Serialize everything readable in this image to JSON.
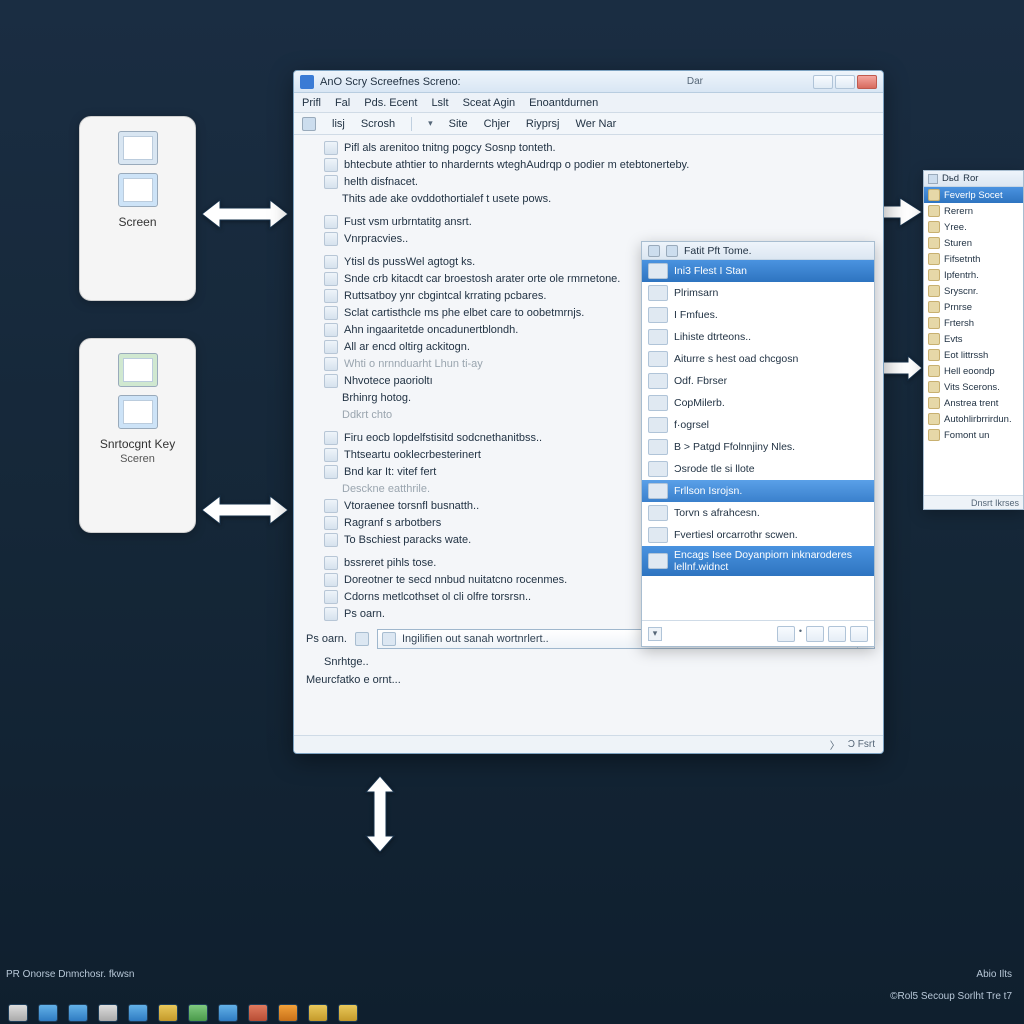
{
  "cards": [
    {
      "label": "Screen"
    },
    {
      "label": "Snrtocgnt Key",
      "sublabel": "Sceren"
    }
  ],
  "window": {
    "title": "AnO Scry Screefnes Screno:",
    "subtitle": "Dar",
    "menu": [
      "Prifl",
      "Fal",
      "Pds. Ecent",
      "Lslt",
      "Sceat Agin",
      "Enoantdurnen"
    ],
    "toolbar": [
      "lisj",
      "Scrosh",
      "Site",
      "Chjer",
      "Riyprsj",
      "Wer Nar"
    ],
    "items": [
      "Pifl als arenitoo tnitng pogcy Sosnp tonteth.",
      "bhtecbute athtier to nhardernts wteghAudrqp o podier m etebtonerteby.",
      "helth disfnacet.",
      "Thits ade ake ovddothortialef t usete pows.",
      "Fust vsm urbrntatitg ansrt.",
      "Vnrpracvies..",
      "Ytisl ds pussWel agtogt ks.",
      "Snde crb kitacdt car broestosh arater orte ole rmrnetone.",
      "Ruttsatboy ynr cbgintcal krrating pcbares.",
      "Sclat cartisthcle ms phe elbet care to oobetmrnjs.",
      "Ahn ingaaritetde oncadunertblondh.",
      "All ar encd oltirg ackitogn.",
      "Whti  o nrnnduarht  Lhun ti‑ay",
      "Nhvotece paorioltı",
      "Brhinrg hotog.",
      "Ddkrt chto",
      "Firu eocb lopdelfstisitd sodcnethanitbss..",
      "Thtseartu ooklecrbesterinert",
      "Bnd kar It: vitef fert",
      "Desckne eatthrile.",
      "Vtoraenee torsnfl busnatth..",
      "Ragranf s arbotbers",
      "To Bschiest paracks wate.",
      "bssreret pihls tose.",
      "Doreotner te secd nnbud nuitatcno rocenmes.",
      "Cdorns metlcothset ol cli olfre torsrsn..",
      "Ps   oarn."
    ],
    "combo": {
      "label": "Ps   oarn.",
      "value": "Ingilifien out sanah wortnrlert.."
    },
    "footer_items": [
      "Snrhtge..",
      "Meurcfatko e ornt..."
    ],
    "status": [
      "〉",
      "Ɔ Fsrt"
    ]
  },
  "panel": {
    "header": "Fatit Pft Tome.",
    "items": [
      "Ini3 Flest I Stan",
      "Plrimsarn",
      "I  Fmfues.",
      "Lihiste dtrteons..",
      "Aiturre s hest oad chcgosn",
      "Odf. Fbrser",
      "CopMilerb.",
      "f·ogrsel",
      "B > Patgd Ffolnnjiny Nles.",
      "Ɔsrode tle si llote",
      "Frllson Isrojsn.",
      "Torvn s afrahcesn.",
      "Fvertiesl orcarrothr scwen.",
      "Encags Isee Doyanpiorn inknaroderes  lellnf.widnct"
    ]
  },
  "rpanel": {
    "header": [
      "Dьd",
      "Ror"
    ],
    "items": [
      "Feverlp Socet",
      "Rerern",
      "Yree.",
      "Sturen",
      "Fifsetnth",
      "Ipfentrh.",
      "Sryscnr.",
      "Prnrse",
      "Frtersh",
      "Evts",
      "Eot littrssh",
      "Hell eoondp",
      "Vits Scerons.",
      "Anstrea trent",
      "Autohlirbrrirdun.",
      "Fomont un"
    ],
    "footer": "Dnsrt Ikrses"
  },
  "footer": {
    "left": "PR Onorse Dnmchosr. fkwsn",
    "right": "Abio Ilts",
    "copyright": "©Rol5 Secoup Sorlht Tre t7"
  }
}
